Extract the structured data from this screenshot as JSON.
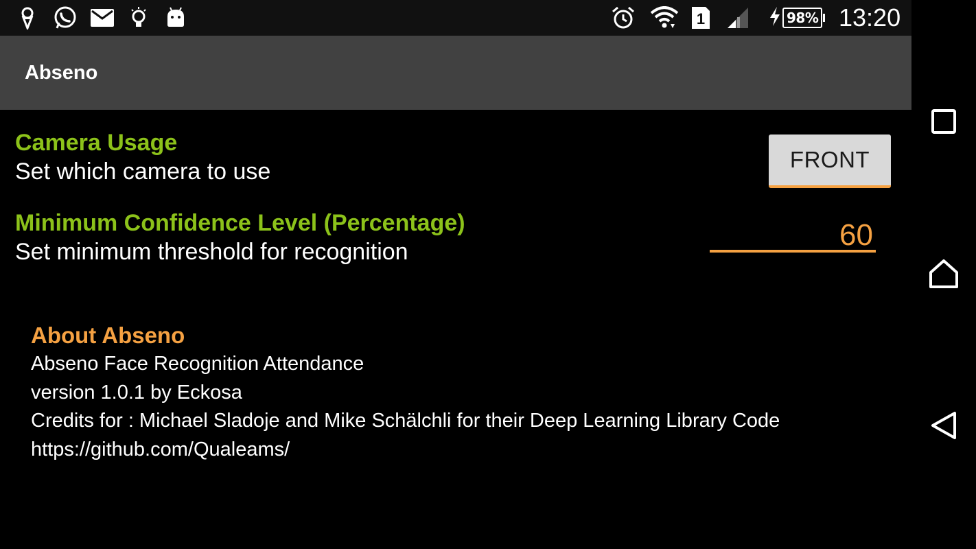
{
  "status_bar": {
    "icons": [
      "ice-cream-icon",
      "whatsapp-icon",
      "mail-icon",
      "lightbulb-icon",
      "android-icon",
      "alarm-icon",
      "wifi-icon",
      "sim-1-icon",
      "signal-icon",
      "charging-icon"
    ],
    "sim_label": "1",
    "battery": "98%",
    "time": "13:20"
  },
  "action_bar": {
    "title": "Abseno"
  },
  "preferences": {
    "camera": {
      "title": "Camera Usage",
      "summary": "Set which camera to use",
      "button_label": "FRONT"
    },
    "confidence": {
      "title": "Minimum Confidence Level (Percentage)",
      "summary": "Set minimum threshold for recognition",
      "value": "60"
    }
  },
  "about": {
    "title": "About Abseno",
    "lines": [
      "Abseno Face Recognition Attendance",
      "version 1.0.1 by Eckosa",
      "Credits for : Michael Sladoje and Mike Schälchli for their Deep Learning Library Code",
      "https://github.com/Qualeams/"
    ]
  },
  "nav_bar": {
    "buttons": [
      "recents-icon",
      "home-icon",
      "back-icon"
    ]
  },
  "colors": {
    "accent_green": "#8cc21a",
    "accent_orange": "#f5a142",
    "action_bar": "#414141",
    "background": "#000000"
  }
}
